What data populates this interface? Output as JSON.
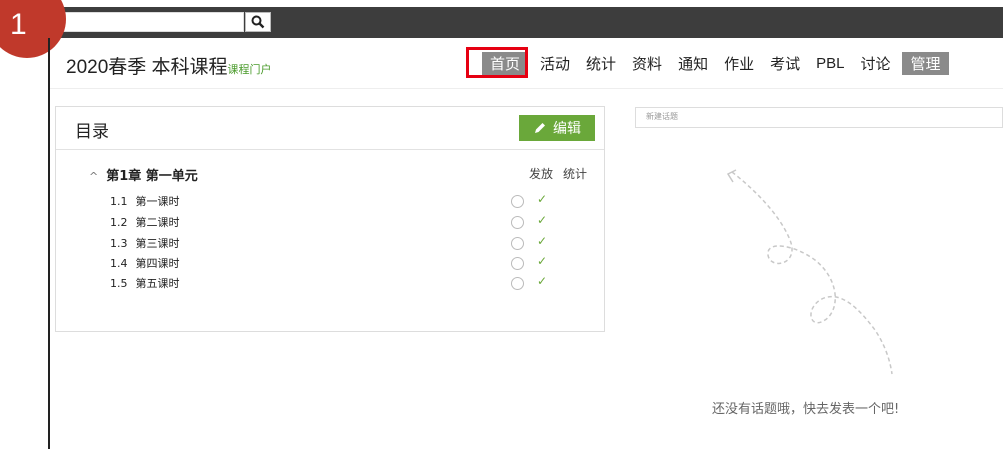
{
  "step_badge": "1",
  "search": {
    "placeholder": ""
  },
  "header": {
    "course_title": "2020春季 本科课程",
    "course_portal": "课程门户"
  },
  "nav": {
    "items": [
      "首页",
      "活动",
      "统计",
      "资料",
      "通知",
      "作业",
      "考试",
      "PBL",
      "讨论",
      "管理"
    ]
  },
  "catalog": {
    "title": "目录",
    "edit_label": "编辑",
    "chapter": "第1章 第一单元",
    "col_publish": "发放",
    "col_stats": "统计",
    "lessons": [
      {
        "num": "1.1",
        "name": "第一课时"
      },
      {
        "num": "1.2",
        "name": "第二课时"
      },
      {
        "num": "1.3",
        "name": "第三课时"
      },
      {
        "num": "1.4",
        "name": "第四课时"
      },
      {
        "num": "1.5",
        "name": "第五课时"
      }
    ]
  },
  "discussion": {
    "new_topic_placeholder": "新建话题",
    "empty_message": "还没有话题哦，快去发表一个吧!"
  },
  "colors": {
    "accent_green": "#6aa83a",
    "highlight_red": "#e60012",
    "badge_red": "#c0392b"
  }
}
